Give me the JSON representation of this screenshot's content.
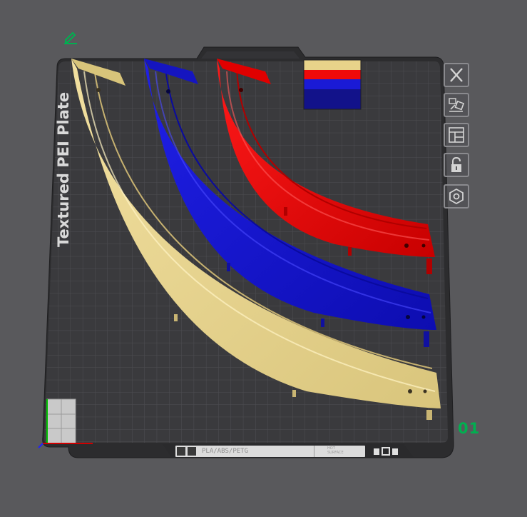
{
  "plate": {
    "name_text": "Textured PEI Plate",
    "number": "01",
    "filament_types": "PLA/ABS/PETG",
    "surface_line1": "HOT",
    "surface_line2": "SURFACE"
  },
  "colors": {
    "background": "#59595c",
    "bed": "#3b3b3d",
    "grid": "#4f4f53",
    "yellow_part": "#e8d38a",
    "blue_part": "#1a1ad6",
    "red_part": "#f00a0a",
    "plate_number": "#00b050",
    "edit_icon": "#00b050"
  },
  "toolbar": {
    "icons": [
      "close-icon",
      "auto-orient-icon",
      "arrange-icon",
      "lock-icon",
      "settings-icon"
    ]
  },
  "footer_icons": [
    "bed-layout-icon",
    "filament-icon",
    "plate-settings-icon"
  ]
}
